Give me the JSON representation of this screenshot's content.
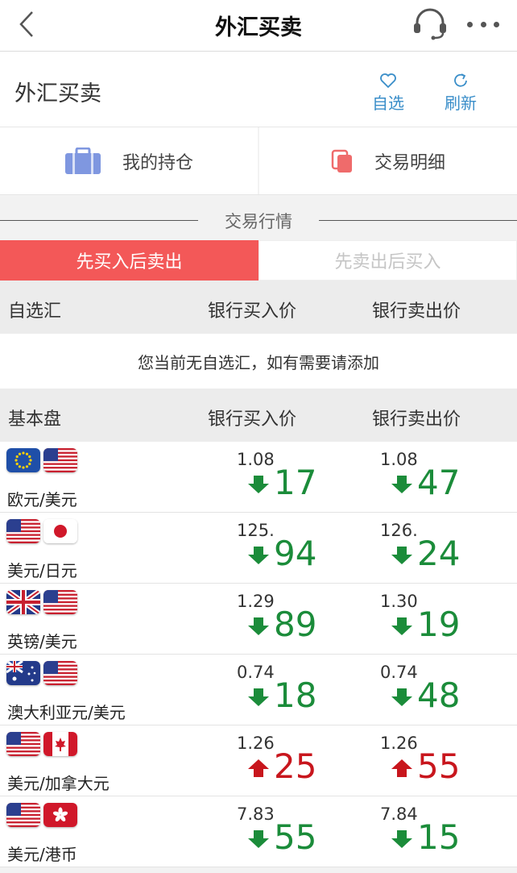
{
  "navbar": {
    "title": "外汇买卖"
  },
  "subheader": {
    "title": "外汇买卖",
    "favorite_label": "自选",
    "refresh_label": "刷新"
  },
  "tiles": {
    "holdings_label": "我的持仓",
    "details_label": "交易明细"
  },
  "section": {
    "title": "交易行情"
  },
  "segment": {
    "buy_first": "先买入后卖出",
    "sell_first": "先卖出后买入"
  },
  "watchlist": {
    "col_name": "自选汇",
    "col_bid": "银行买入价",
    "col_ask": "银行卖出价",
    "empty_text": "您当前无自选汇，如有需要请添加"
  },
  "base": {
    "col_name": "基本盘",
    "col_bid": "银行买入价",
    "col_ask": "银行卖出价"
  },
  "colors": {
    "down": "#1b8c3a",
    "up": "#c8161d",
    "accent": "#f35858"
  },
  "rows": [
    {
      "pair": "欧元/美元",
      "flags": [
        "eu-flag",
        "us-flag"
      ],
      "bid_small": "1.08",
      "bid_big": "17",
      "bid_dir": "down",
      "ask_small": "1.08",
      "ask_big": "47",
      "ask_dir": "down"
    },
    {
      "pair": "美元/日元",
      "flags": [
        "us-flag",
        "jp-flag"
      ],
      "bid_small": "125.",
      "bid_big": "94",
      "bid_dir": "down",
      "ask_small": "126.",
      "ask_big": "24",
      "ask_dir": "down"
    },
    {
      "pair": "英镑/美元",
      "flags": [
        "uk-flag",
        "us-flag"
      ],
      "bid_small": "1.29",
      "bid_big": "89",
      "bid_dir": "down",
      "ask_small": "1.30",
      "ask_big": "19",
      "ask_dir": "down"
    },
    {
      "pair": "澳大利亚元/美元",
      "flags": [
        "au-flag",
        "us-flag"
      ],
      "bid_small": "0.74",
      "bid_big": "18",
      "bid_dir": "down",
      "ask_small": "0.74",
      "ask_big": "48",
      "ask_dir": "down"
    },
    {
      "pair": "美元/加拿大元",
      "flags": [
        "us-flag",
        "ca-flag"
      ],
      "bid_small": "1.26",
      "bid_big": "25",
      "bid_dir": "up",
      "ask_small": "1.26",
      "ask_big": "55",
      "ask_dir": "up"
    },
    {
      "pair": "美元/港币",
      "flags": [
        "us-flag",
        "hk-flag"
      ],
      "bid_small": "7.83",
      "bid_big": "55",
      "bid_dir": "down",
      "ask_small": "7.84",
      "ask_big": "15",
      "ask_dir": "down"
    }
  ]
}
